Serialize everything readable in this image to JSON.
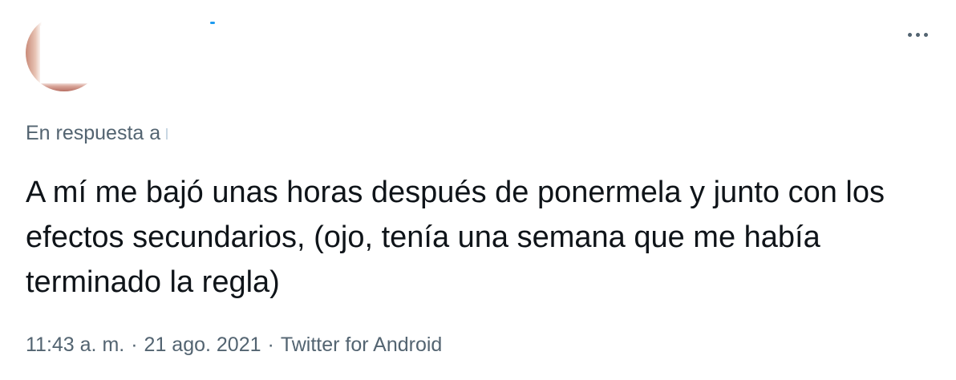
{
  "tweet": {
    "reply_prefix": "En respuesta a",
    "text": "A mí me bajó unas horas después de ponermela y junto con los efectos secundarios, (ojo, tenía una semana que me había terminado la regla)",
    "time": "11:43 a. m.",
    "date": "21 ago. 2021",
    "source": "Twitter for Android",
    "separator": "·"
  },
  "icons": {
    "more": "more-horizontal-icon",
    "verified": "verified-badge-icon"
  },
  "colors": {
    "text_primary": "#0f1419",
    "text_secondary": "#536471",
    "accent": "#1d9bf0",
    "background": "#ffffff"
  }
}
